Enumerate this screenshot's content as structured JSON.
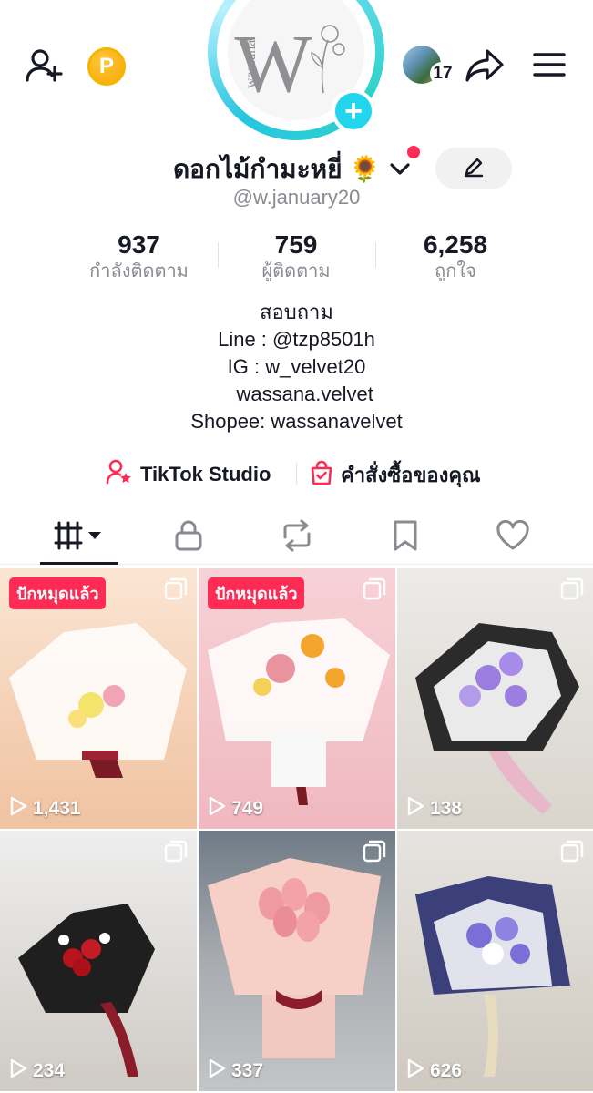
{
  "header": {
    "coin_label": "P",
    "friends_count": "17"
  },
  "profile": {
    "display_name": "ดอกไม้กำมะหยี่ 🌻",
    "username": "@w.january20",
    "avatar_logo_text": "W",
    "avatar_logo_script": "wassana"
  },
  "stats": [
    {
      "value": "937",
      "label": "กำลังติดตาม"
    },
    {
      "value": "759",
      "label": "ผู้ติดตาม"
    },
    {
      "value": "6,258",
      "label": "ถูกใจ"
    }
  ],
  "bio": [
    "สอบถาม",
    "Line : @tzp8501h",
    "IG : w_velvet20",
    "   wassana.velvet",
    "Shopee: wassanavelvet"
  ],
  "links": {
    "studio": "TikTok Studio",
    "orders": "คำสั่งซื้อของคุณ"
  },
  "tabs": [
    "videos",
    "private",
    "reposts",
    "favorites",
    "liked"
  ],
  "videos": [
    {
      "pinned": true,
      "pin_label": "ปักหมุดแล้ว",
      "views": "1,431",
      "bg": "#f6dcc3"
    },
    {
      "pinned": true,
      "pin_label": "ปักหมุดแล้ว",
      "views": "749",
      "bg": "#f3c6cc"
    },
    {
      "pinned": false,
      "views": "138",
      "bg": "#dedad4"
    },
    {
      "pinned": false,
      "views": "234",
      "bg": "#d8d6d2"
    },
    {
      "pinned": false,
      "views": "337",
      "bg": "#b9bcc0"
    },
    {
      "pinned": false,
      "views": "626",
      "bg": "#d8d4cd"
    }
  ],
  "colors": {
    "accent": "#fe2c55",
    "avatar_plus": "#20d5ec",
    "coin": "#f5a300",
    "text_primary": "#161823",
    "text_secondary": "#8a8b91"
  }
}
